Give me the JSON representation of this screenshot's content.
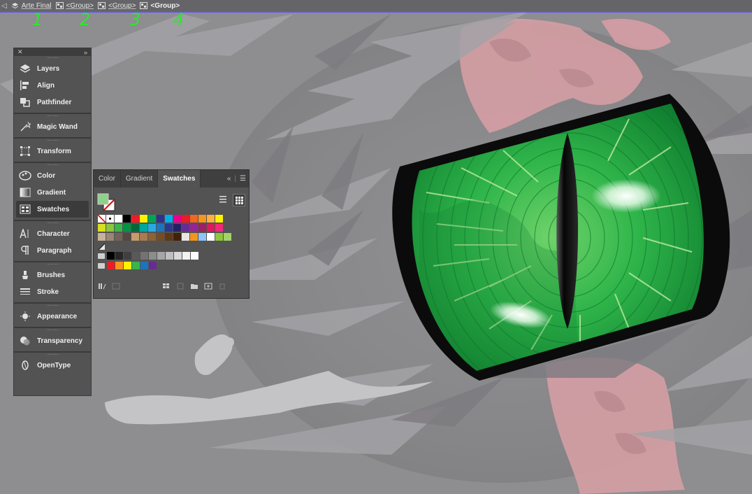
{
  "breadcrumb": [
    {
      "label": "Arte Final"
    },
    {
      "label": "<Group>"
    },
    {
      "label": "<Group>"
    },
    {
      "label": "<Group>"
    }
  ],
  "annotations": [
    "1",
    "2",
    "3",
    "4"
  ],
  "dock": {
    "items": [
      {
        "label": "Layers",
        "icon": "layers-icon"
      },
      {
        "label": "Align",
        "icon": "align-icon"
      },
      {
        "label": "Pathfinder",
        "icon": "pathfinder-icon"
      },
      {
        "label": "Magic Wand",
        "icon": "magic-wand-icon"
      },
      {
        "label": "Transform",
        "icon": "transform-icon"
      },
      {
        "label": "Color",
        "icon": "color-icon"
      },
      {
        "label": "Gradient",
        "icon": "gradient-icon"
      },
      {
        "label": "Swatches",
        "icon": "swatches-icon"
      },
      {
        "label": "Character",
        "icon": "character-icon"
      },
      {
        "label": "Paragraph",
        "icon": "paragraph-icon"
      },
      {
        "label": "Brushes",
        "icon": "brushes-icon"
      },
      {
        "label": "Stroke",
        "icon": "stroke-icon"
      },
      {
        "label": "Appearance",
        "icon": "appearance-icon"
      },
      {
        "label": "Transparency",
        "icon": "transparency-icon"
      },
      {
        "label": "OpenType",
        "icon": "opentype-icon"
      }
    ]
  },
  "swatches_panel": {
    "tabs": [
      {
        "label": "Color"
      },
      {
        "label": "Gradient"
      },
      {
        "label": "Swatches",
        "active": true
      }
    ],
    "current_fill": "#8fd08a",
    "row1": [
      "none",
      "registration",
      "#ffffff",
      "#000000",
      "#ed1c24",
      "#fff200",
      "#00a651",
      "#2e3192",
      "#00aeef",
      "#ec008c",
      "#ed1c24",
      "#f26522",
      "#f7941d",
      "#fbb040",
      "#fff200"
    ],
    "row2": [
      "#d7df23",
      "#8dc63f",
      "#39b54a",
      "#009444",
      "#006838",
      "#00a79d",
      "#27aae1",
      "#1c75bc",
      "#2b388f",
      "#262262",
      "#662d91",
      "#92278f",
      "#9e1f63",
      "#da1c5c",
      "#ee2a7b"
    ],
    "row3": [
      "#c7b299",
      "#998675",
      "#736357",
      "#534741",
      "#c69c6d",
      "#a67c52",
      "#8c6239",
      "#754c24",
      "#603813",
      "#42210b",
      "#e6e6e6",
      "#f7941d",
      "#92c5f7",
      "#ffffff",
      "#8dc63f",
      "#a0d468"
    ],
    "gray_group": [
      "#000000",
      "#262626",
      "#404040",
      "#595959",
      "#737373",
      "#8c8c8c",
      "#a6a6a6",
      "#bfbfbf",
      "#d9d9d9",
      "#f2f2f2",
      "#ffffff"
    ],
    "color_group": [
      "#ed1c24",
      "#f7941d",
      "#fff200",
      "#39b54a",
      "#1c75bc",
      "#662d91"
    ]
  },
  "colors": {
    "canvas": "#8e8d90",
    "pink": "#d9a0a6",
    "iris": "#2bb24b",
    "iris_dark": "#0f7a2a",
    "outline": "#0b0b0b"
  }
}
